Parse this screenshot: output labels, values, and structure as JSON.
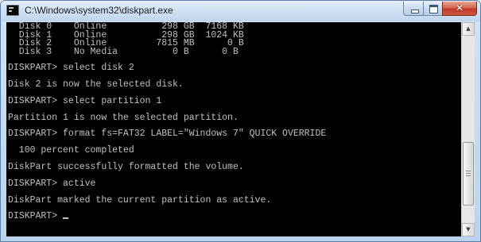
{
  "window": {
    "title": "C:\\Windows\\system32\\diskpart.exe",
    "app_icon": "console-icon",
    "controls": {
      "minimize_icon": "minimize-icon",
      "maximize_icon": "maximize-icon",
      "close_icon": "close-icon",
      "close_glyph": "✕"
    }
  },
  "console": {
    "foreground": "#c0c0c0",
    "background": "#000000",
    "lines": [
      "  --------  -------------  -------  -------  ---  ---",
      "  Disk 0    Online          298 GB  7168 KB",
      "  Disk 1    Online          298 GB  1024 KB",
      "  Disk 2    Online         7815 MB      0 B",
      "  Disk 3    No Media          0 B      0 B",
      "",
      "DISKPART> select disk 2",
      "",
      "Disk 2 is now the selected disk.",
      "",
      "DISKPART> select partition 1",
      "",
      "Partition 1 is now the selected partition.",
      "",
      "DISKPART> format fs=FAT32 LABEL=\"Windows 7\" QUICK OVERRIDE",
      "",
      "  100 percent completed",
      "",
      "DiskPart successfully formatted the volume.",
      "",
      "DISKPART> active",
      "",
      "DiskPart marked the current partition as active.",
      "",
      "DISKPART> "
    ]
  },
  "scrollbar": {
    "up_arrow": "▲",
    "down_arrow": "▼",
    "position_fraction": 0.86
  }
}
